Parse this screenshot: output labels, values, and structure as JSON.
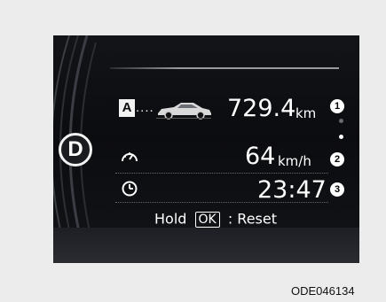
{
  "gear": "D",
  "trip": {
    "badge": "A",
    "dots": "....",
    "icon": "car-icon",
    "distance_value": "729.4",
    "distance_unit": "km",
    "callout": "1"
  },
  "speed": {
    "icon": "speedometer-icon",
    "value": "64",
    "unit": "km/h",
    "callout": "2"
  },
  "time": {
    "icon": "clock-icon",
    "value": "23:47",
    "callout": "3"
  },
  "reset": {
    "hold_label": "Hold",
    "key_label": "OK",
    "reset_label": ": Reset"
  },
  "caption": "ODE046134",
  "colors": {
    "display_background": "#0b0c0f",
    "text": "#ffffff",
    "page_background": "#ececec"
  }
}
